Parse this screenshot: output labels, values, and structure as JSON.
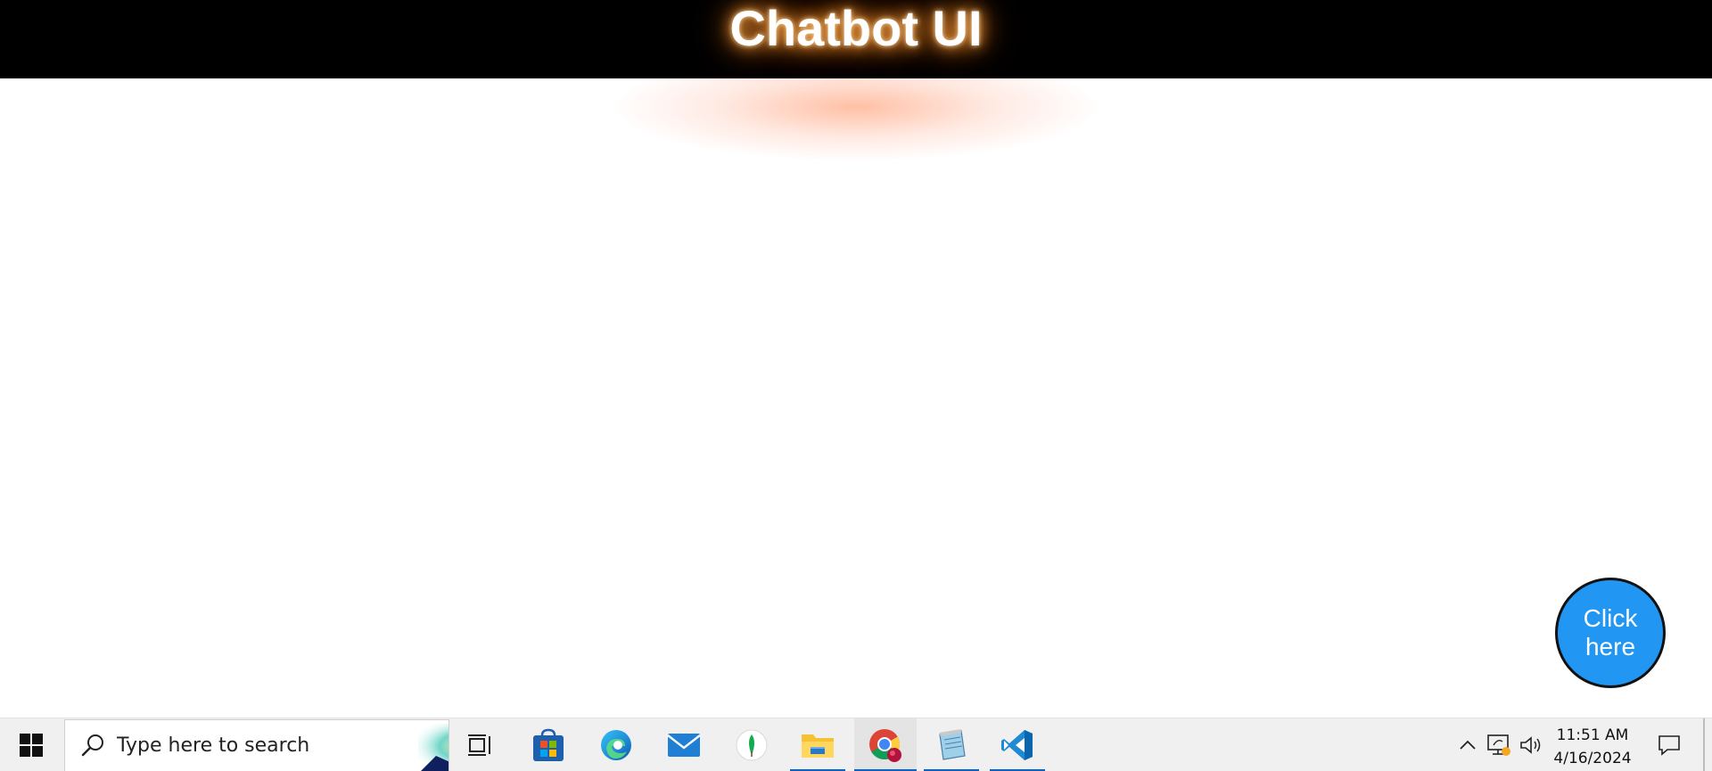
{
  "header": {
    "title": "Chatbot UI"
  },
  "chat_button": {
    "label": "Click\nhere",
    "color": "#2196f3"
  },
  "taskbar": {
    "search_placeholder": "Type here to search",
    "apps": [
      {
        "icon": "task-view-icon",
        "running": false
      },
      {
        "icon": "microsoft-store-icon",
        "running": false
      },
      {
        "icon": "edge-icon",
        "running": false
      },
      {
        "icon": "mail-icon",
        "running": false
      },
      {
        "icon": "mongodb-compass-icon",
        "running": false
      },
      {
        "icon": "file-explorer-icon",
        "running": true
      },
      {
        "icon": "chrome-icon",
        "running": true
      },
      {
        "icon": "notepad-icon",
        "running": true
      },
      {
        "icon": "vscode-icon",
        "running": true
      }
    ],
    "tray_icons": [
      "chevron-up-icon",
      "network-icon",
      "volume-icon",
      "notification-icon"
    ],
    "clock": {
      "time": "11:51 AM",
      "date": "4/16/2024"
    },
    "accent_color": "#0a64c8"
  }
}
